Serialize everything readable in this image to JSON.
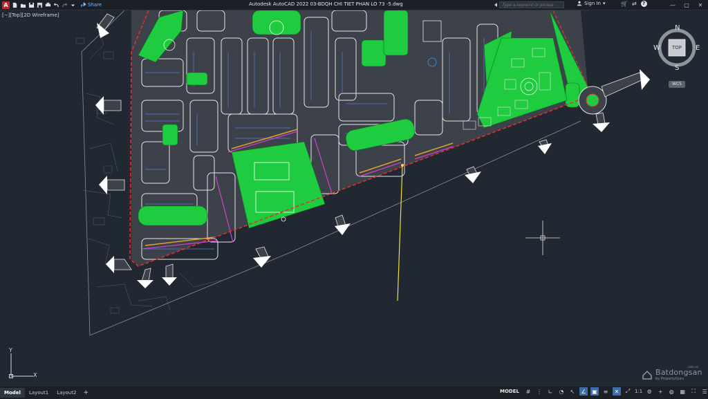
{
  "app": {
    "title": "Autodesk AutoCAD 2022    03-BDQH CHI TIET PHAN LO 73 -5.dwg",
    "logo_letter": "A",
    "share_label": "Share"
  },
  "search": {
    "placeholder": "Type a keyword or phrase"
  },
  "account": {
    "signin_label": "Sign In"
  },
  "viewport": {
    "label": "[−][Top][2D Wireframe]"
  },
  "viewcube": {
    "north": "N",
    "south": "S",
    "east": "E",
    "west": "W",
    "face": "TOP",
    "wcs": "WCS"
  },
  "ucs": {
    "x": "X",
    "y": "Y"
  },
  "watermark": {
    "brand": "Batdongsan",
    "sub": "by PropertyGuru",
    "domain": ".com.vn"
  },
  "layout_tabs": [
    {
      "label": "Model"
    },
    {
      "label": "Layout1"
    },
    {
      "label": "Layout2"
    }
  ],
  "status": {
    "model_label": "MODEL",
    "scale": "1:1"
  },
  "colors": {
    "green": "#1fcc3f",
    "road": "#c9c9c9",
    "bg": "#212832",
    "red_boundary": "#e03030",
    "yellow_leader": "#f0e040"
  }
}
